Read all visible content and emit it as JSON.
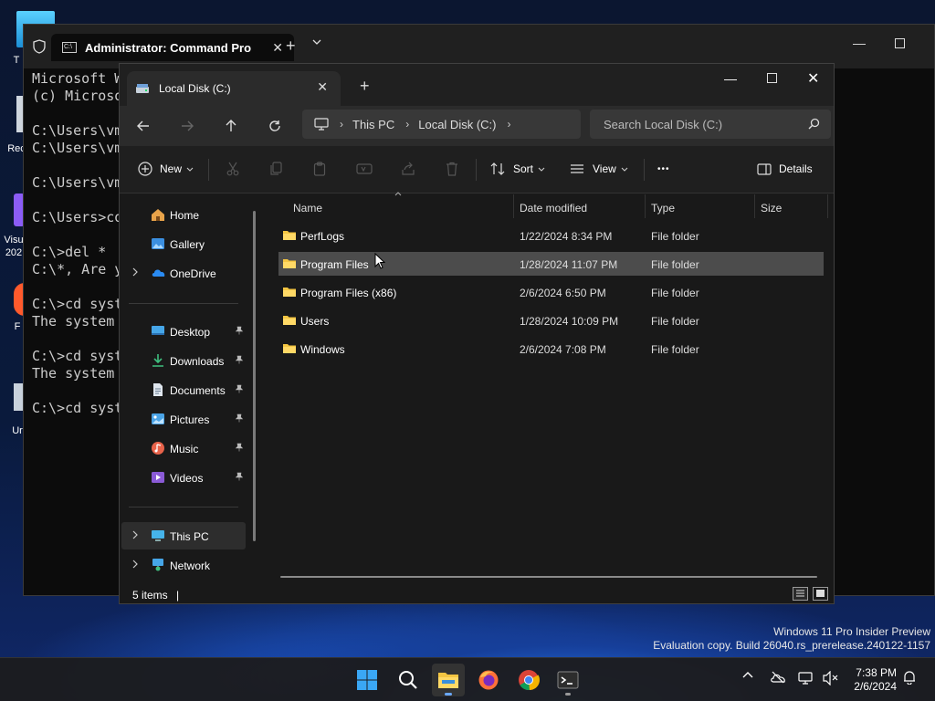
{
  "desktop": {
    "icons": [
      {
        "label": "T",
        "icon": "folder-icon"
      },
      {
        "label": "Rec",
        "icon": "recycle-bin-icon"
      },
      {
        "label": "Visu\n202",
        "icon": "visual-studio-icon"
      },
      {
        "label": "F",
        "icon": "firefox-icon"
      },
      {
        "label": "Ur",
        "icon": "uninstall-icon"
      }
    ]
  },
  "cmd": {
    "tab_title": "Administrator: Command Pro",
    "lines": [
      "Microsoft W",
      "(c) Microso",
      "",
      "C:\\Users\\vm",
      "C:\\Users\\vm",
      "",
      "C:\\Users\\vm",
      "",
      "C:\\Users>co",
      "",
      "C:\\>del *",
      "C:\\*, Are y",
      "",
      "C:\\>cd syst",
      "The system",
      "",
      "C:\\>cd syst",
      "The system",
      "",
      "C:\\>cd syst"
    ]
  },
  "explorer": {
    "tab_title": "Local Disk (C:)",
    "breadcrumb": [
      "This PC",
      "Local Disk (C:)"
    ],
    "search_placeholder": "Search Local Disk (C:)",
    "toolbar": {
      "new": "New",
      "sort": "Sort",
      "view": "View",
      "more": "•••",
      "details": "Details"
    },
    "sidebar": {
      "quick": [
        {
          "label": "Home",
          "icon": "home-icon"
        },
        {
          "label": "Gallery",
          "icon": "gallery-icon"
        },
        {
          "label": "OneDrive",
          "icon": "onedrive-icon"
        }
      ],
      "pinned": [
        {
          "label": "Desktop",
          "icon": "desktop-icon"
        },
        {
          "label": "Downloads",
          "icon": "downloads-icon"
        },
        {
          "label": "Documents",
          "icon": "documents-icon"
        },
        {
          "label": "Pictures",
          "icon": "pictures-icon"
        },
        {
          "label": "Music",
          "icon": "music-icon"
        },
        {
          "label": "Videos",
          "icon": "videos-icon"
        }
      ],
      "devices": [
        {
          "label": "This PC",
          "icon": "this-pc-icon",
          "selected": true
        },
        {
          "label": "Network",
          "icon": "network-icon"
        }
      ]
    },
    "columns": {
      "name": "Name",
      "date": "Date modified",
      "type": "Type",
      "size": "Size"
    },
    "rows": [
      {
        "name": "PerfLogs",
        "date": "1/22/2024 8:34 PM",
        "type": "File folder"
      },
      {
        "name": "Program Files",
        "date": "1/28/2024 11:07 PM",
        "type": "File folder",
        "hover": true
      },
      {
        "name": "Program Files (x86)",
        "date": "2/6/2024 6:50 PM",
        "type": "File folder"
      },
      {
        "name": "Users",
        "date": "1/28/2024 10:09 PM",
        "type": "File folder"
      },
      {
        "name": "Windows",
        "date": "2/6/2024 7:08 PM",
        "type": "File folder"
      }
    ],
    "status": "5 items"
  },
  "watermark": {
    "line1": "Windows 11 Pro Insider Preview",
    "line2": "Evaluation copy. Build 26040.rs_prerelease.240122-1157"
  },
  "taskbar": {
    "apps": [
      "start-icon",
      "search-icon",
      "file-explorer-icon",
      "firefox-icon",
      "chrome-icon",
      "terminal-icon"
    ],
    "time": "7:38 PM",
    "date": "2/6/2024"
  },
  "colors": {
    "folder": "#f4c542",
    "accent": "#4cc2ff",
    "explorer_bg": "#191919",
    "hover_row": "#4c4c4c"
  }
}
